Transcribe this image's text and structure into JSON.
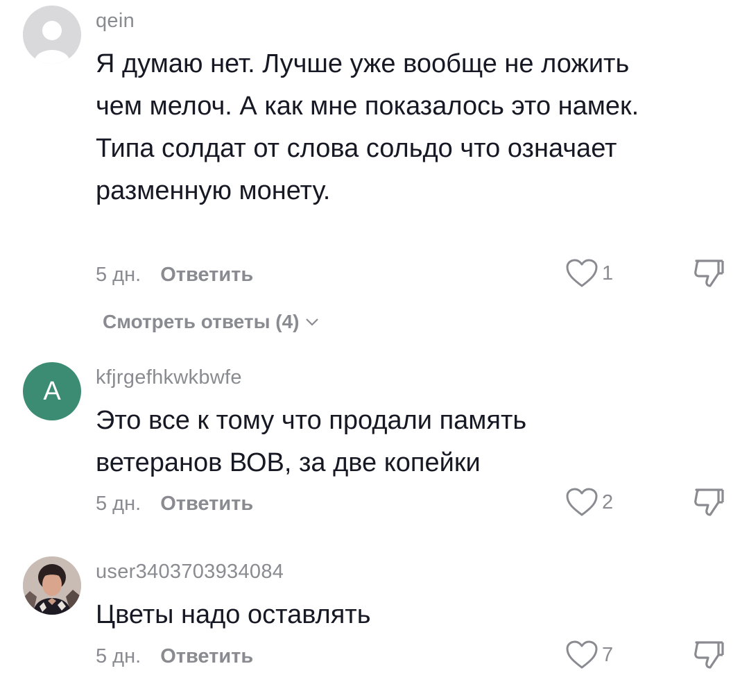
{
  "colors": {
    "text_primary": "#161823",
    "text_secondary": "#8a8b91",
    "avatar_letter_bg": "#3b8c72",
    "avatar_default_bg": "#d9d9dc"
  },
  "comments": [
    {
      "username": "qein",
      "avatar": "default-avatar",
      "text": "Я думаю нет. Лучше уже вообще не ложить чем мелоч. А как мне показалось это намек. Типа солдат от слова сольдо что означает разменную монету.",
      "time": "5 дн.",
      "reply_label": "Ответить",
      "likes": "1",
      "view_replies_label": "Смотреть ответы (4)"
    },
    {
      "username": "kfjrgefhkwkbwfe",
      "avatar": "letter-avatar",
      "avatar_letter": "A",
      "text": "Это все к тому что продали память ветеранов ВОВ, за две копейки",
      "time": "5 дн.",
      "reply_label": "Ответить",
      "likes": "2"
    },
    {
      "username": "user3403703934084",
      "avatar": "photo-avatar",
      "text": "Цветы надо оставлять",
      "time": "5 дн.",
      "reply_label": "Ответить",
      "likes": "7"
    }
  ]
}
